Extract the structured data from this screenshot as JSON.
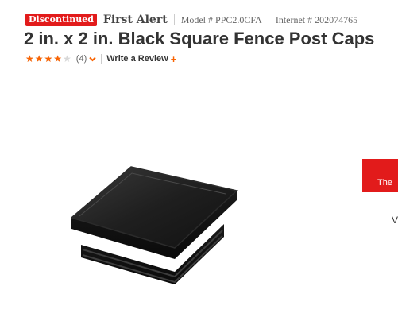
{
  "product": {
    "status_badge": "Discontinued",
    "brand": "First Alert",
    "model_label": "Model # PPC2.0CFA",
    "internet_label": "Internet # 202074765",
    "title": "2 in. x 2 in. Black Square Fence Post Caps"
  },
  "rating": {
    "stars": 4,
    "max_stars": 5,
    "count_label": "(4)",
    "write_review_label": "Write a Review",
    "plus_symbol": "+"
  },
  "side_panel": {
    "promo_text": "The",
    "side_text": "V"
  },
  "icons": {
    "rating_dropdown": "chevron-down-icon",
    "write_review_add": "plus-icon"
  },
  "colors": {
    "accent": "#f96302",
    "badge": "#e21b1b",
    "title": "#333333"
  }
}
